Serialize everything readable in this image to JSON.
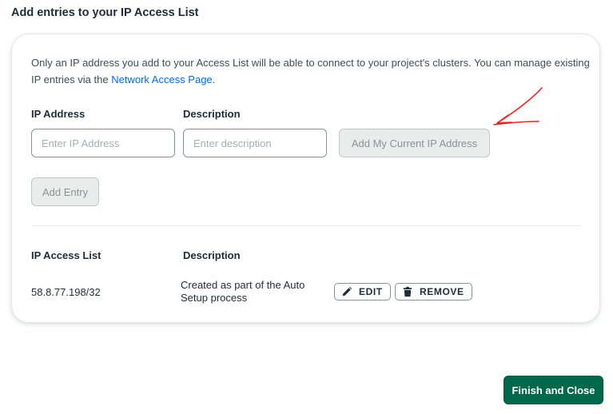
{
  "modal": {
    "title": "Add entries to your IP Access List",
    "intro_text": "Only an IP address you add to your Access List will be able to connect to your project's clusters. You can manage existing IP entries via the",
    "intro_link": "Network Access Page",
    "intro_end": "."
  },
  "form": {
    "ip_label": "IP Address",
    "ip_placeholder": "Enter IP Address",
    "ip_value": "",
    "desc_label": "Description",
    "desc_placeholder": "Enter description",
    "desc_value": "",
    "add_current_ip_label": "Add My Current IP Address",
    "add_entry_label": "Add Entry"
  },
  "access_list": {
    "col_ip": "IP Access List",
    "col_desc": "Description",
    "rows": [
      {
        "ip": "58.8.77.198/32",
        "description": "Created as part of the Auto Setup process",
        "edit_label": "EDIT",
        "remove_label": "REMOVE"
      }
    ]
  },
  "footer": {
    "finish_label": "Finish and Close"
  },
  "annotation": {
    "arrow_color": "#e8231c"
  },
  "colors": {
    "primary_green": "#00684a",
    "link_blue": "#016bf8",
    "disabled_bg": "#e8edeb"
  }
}
